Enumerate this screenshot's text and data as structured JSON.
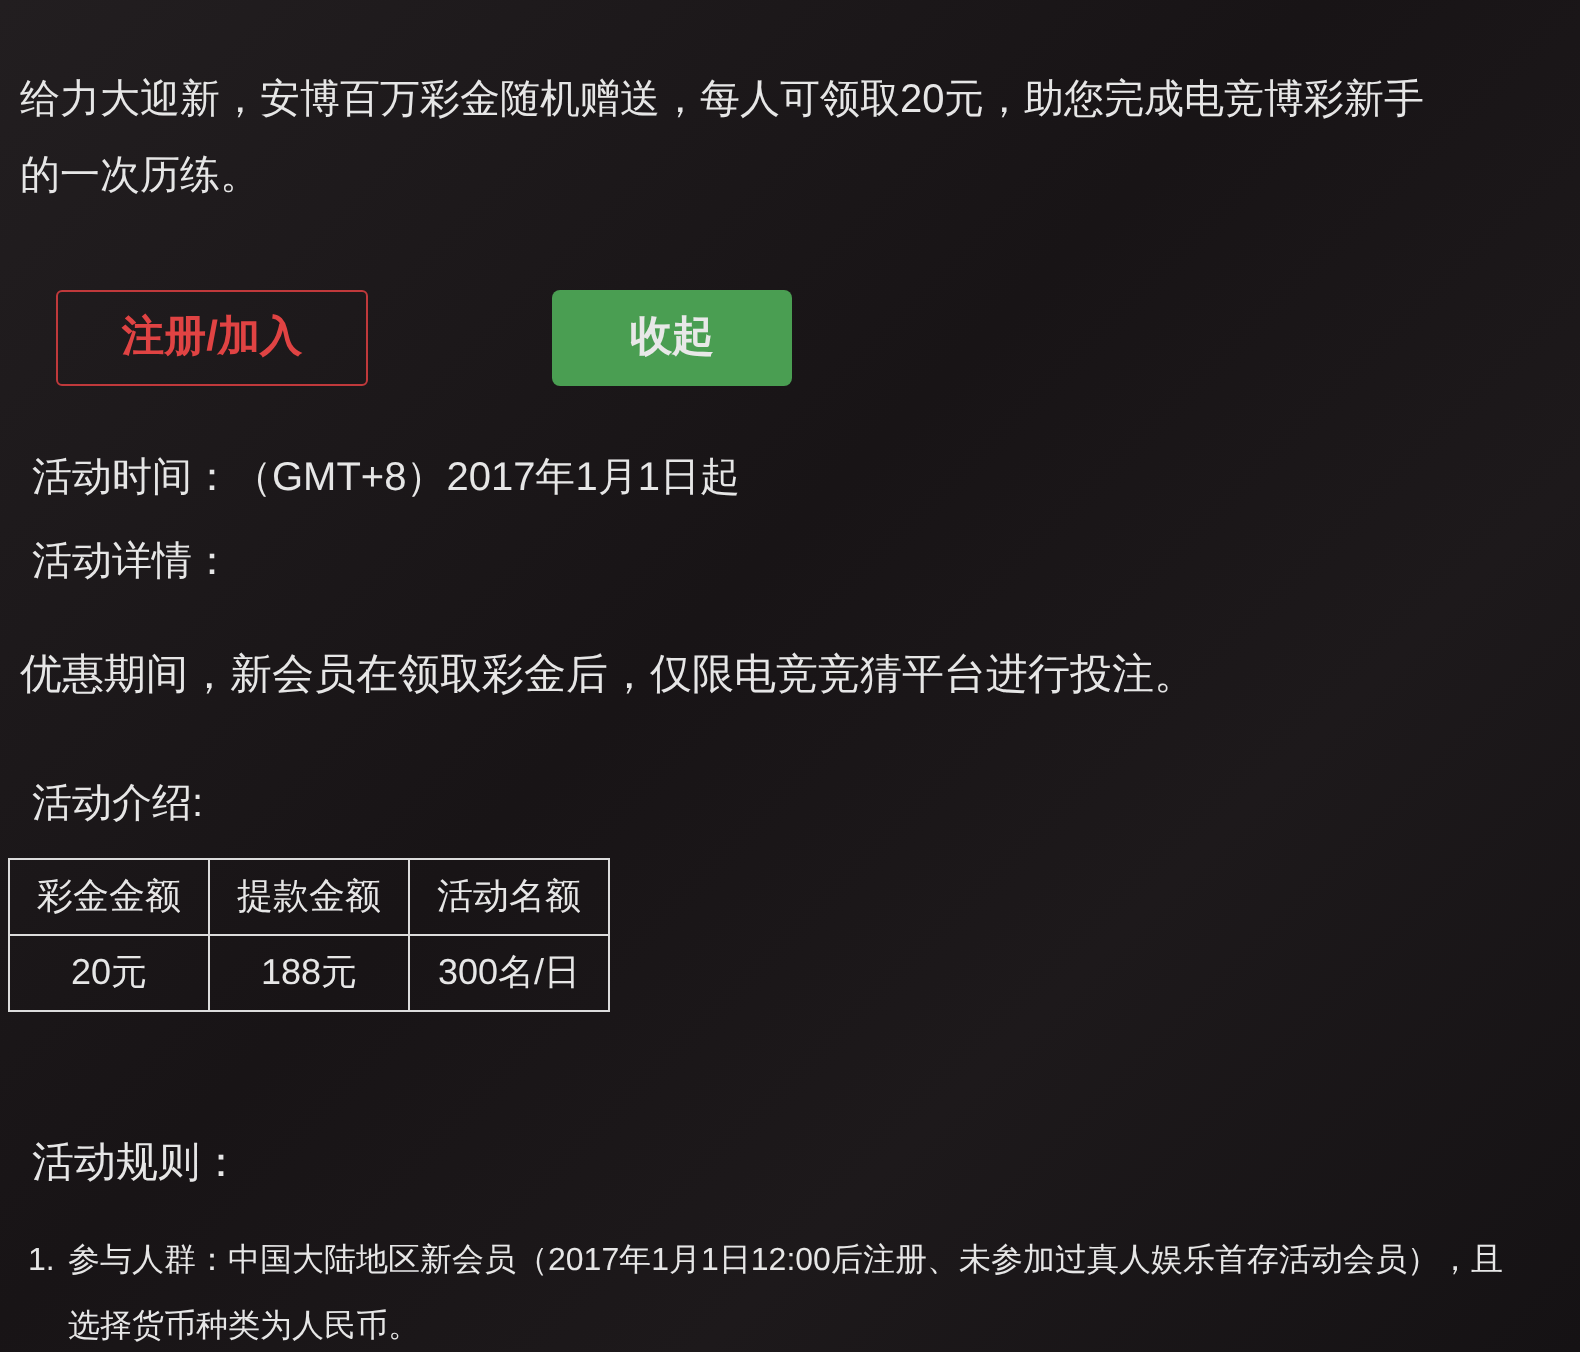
{
  "intro": "给力大迎新，安博百万彩金随机赠送，每人可领取20元，助您完成电竞博彩新手的一次历练。",
  "buttons": [
    {
      "label": "注册/加入",
      "kind": "outline"
    },
    {
      "label": "收起",
      "kind": "filled"
    }
  ],
  "activity_time": "活动时间：（GMT+8）2017年1月1日起",
  "details_heading": "活动详情：",
  "details_text": "优惠期间，新会员在领取彩金后，仅限电竞竞猜平台进行投注。",
  "intro_heading": "活动介绍:",
  "table": {
    "columns": [
      "彩金金额",
      "提款金额",
      "活动名额"
    ],
    "rows": [
      [
        "20元",
        "188元",
        "300名/日"
      ]
    ]
  },
  "rules_heading": "活动规则：",
  "rules": [
    {
      "number": "1.",
      "text": "参与人群：中国大陆地区新会员（2017年1月1日12:00后注册、未参加过真人娱乐首存活动会员），且选择货币种类为人民币。"
    }
  ]
}
